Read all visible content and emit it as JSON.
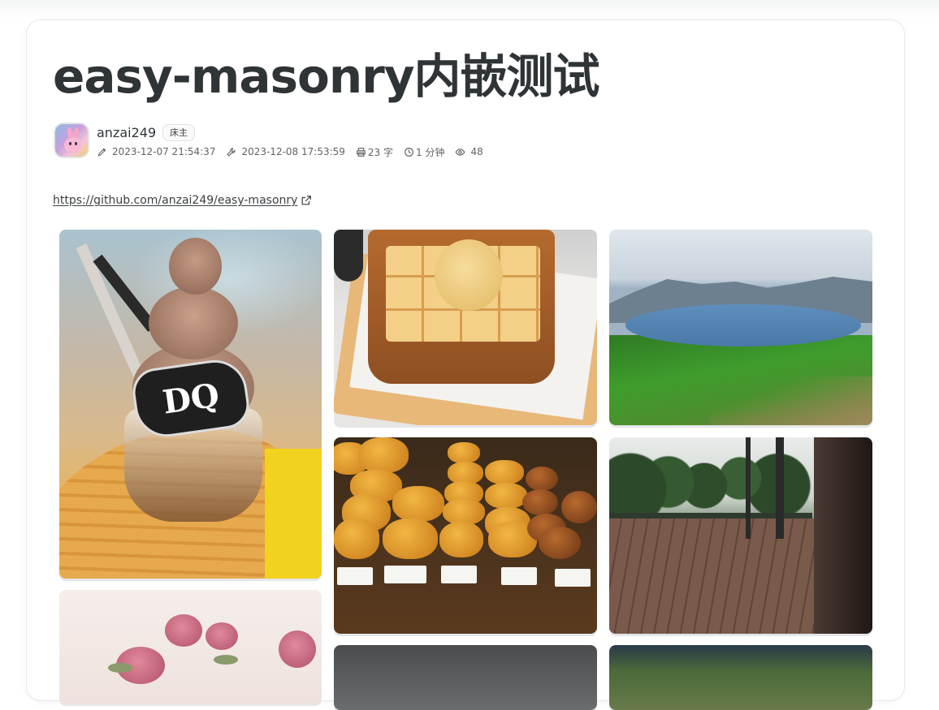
{
  "post": {
    "title": "easy-masonry内嵌测试",
    "author": "anzai249",
    "badge": "床主",
    "created": "2023-12-07 21:54:37",
    "updated": "2023-12-08 17:53:59",
    "word_count": "23 字",
    "read_time": "1 分钟",
    "views": "48",
    "link_text": "https://github.com/anzai249/easy-masonry"
  },
  "icons": {
    "created": "pencil-icon",
    "updated": "wrench-icon",
    "word_count": "printer-icon",
    "read_time": "clock-icon",
    "views": "eye-icon",
    "link": "external-link-icon"
  },
  "gallery": {
    "images": [
      {
        "subject": "Dairy Queen ice cream sundae",
        "logo_text": "DQ"
      },
      {
        "subject": "honey toast with ice cream"
      },
      {
        "subject": "mountain crater lake"
      },
      {
        "subject": "bakery pastry display"
      },
      {
        "subject": "wooden deck with trees"
      },
      {
        "subject": "pink roses"
      },
      {
        "subject": "dark photo (partially visible)"
      },
      {
        "subject": "green mountains (partially visible)"
      }
    ]
  }
}
